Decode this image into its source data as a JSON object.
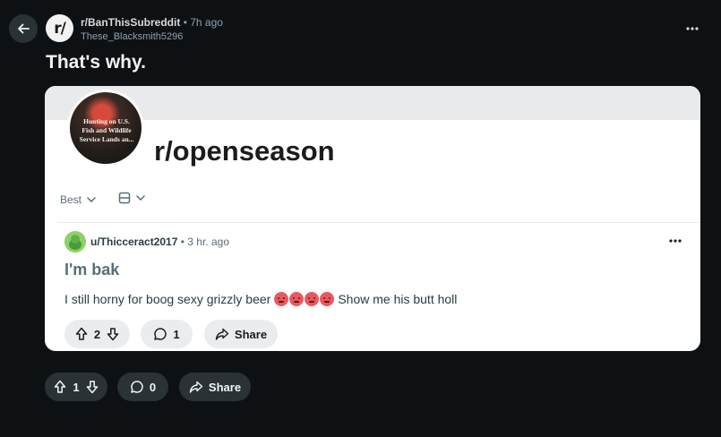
{
  "header": {
    "subreddit": "r/BanThisSubreddit",
    "separator": "•",
    "time": "7h ago",
    "username": "These_Blacksmith5296",
    "avatar_text": "r/"
  },
  "post": {
    "title": "That's why.",
    "votes": "1",
    "comments": "0",
    "share_label": "Share"
  },
  "embed": {
    "community_name": "r/openseason",
    "avatar_caption": "Hunting on U.S. Fish and Wildlife Service Lands an...",
    "sort_label": "Best",
    "comment": {
      "username": "u/Thicceract2017",
      "separator": "•",
      "time": "3 hr. ago",
      "title": "I'm bak",
      "body_before": "I still horny for boog sexy grizzly beer",
      "emoji_name": "hot-face",
      "emoji_count": 4,
      "body_after": "Show me his butt holl",
      "votes": "2",
      "replies": "1",
      "share_label": "Share"
    }
  },
  "colors": {
    "background": "#0e1113",
    "embed_background": "#ffffff",
    "pill_dark": "#2a3236",
    "pill_light": "#eaedef"
  }
}
